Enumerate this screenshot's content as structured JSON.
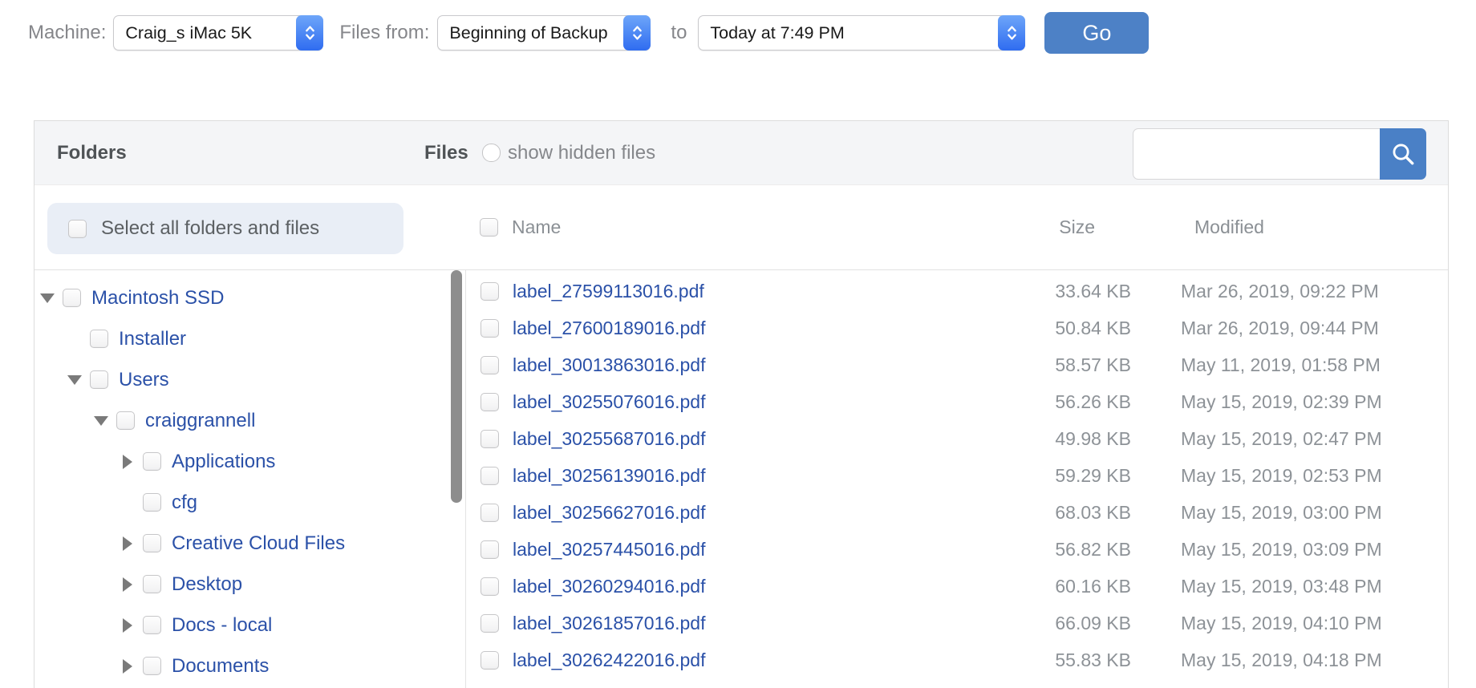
{
  "toolbar": {
    "machine_label": "Machine:",
    "machine_value": "Craig_s iMac 5K",
    "files_from_label": "Files from:",
    "files_from_value": "Beginning of Backup",
    "to_label": "to",
    "to_value": "Today at 7:49 PM",
    "go_label": "Go"
  },
  "panel": {
    "folders_title": "Folders",
    "files_title": "Files",
    "show_hidden_label": "show hidden files",
    "search_placeholder": "",
    "select_all_label": "Select all folders and files",
    "columns": {
      "name": "Name",
      "size": "Size",
      "modified": "Modified"
    }
  },
  "folder_tree": [
    {
      "label": "Macintosh SSD",
      "level": 0,
      "expand": "open"
    },
    {
      "label": "Installer",
      "level": 1,
      "expand": "none"
    },
    {
      "label": "Users",
      "level": 1,
      "expand": "open"
    },
    {
      "label": "craiggrannell",
      "level": 2,
      "expand": "open"
    },
    {
      "label": "Applications",
      "level": 3,
      "expand": "closed"
    },
    {
      "label": "cfg",
      "level": 3,
      "expand": "none"
    },
    {
      "label": "Creative Cloud Files",
      "level": 3,
      "expand": "closed"
    },
    {
      "label": "Desktop",
      "level": 3,
      "expand": "closed"
    },
    {
      "label": "Docs - local",
      "level": 3,
      "expand": "closed"
    },
    {
      "label": "Documents",
      "level": 3,
      "expand": "closed"
    }
  ],
  "files": [
    {
      "name": "label_27599113016.pdf",
      "size": "33.64 KB",
      "modified": "Mar 26, 2019, 09:22 PM"
    },
    {
      "name": "label_27600189016.pdf",
      "size": "50.84 KB",
      "modified": "Mar 26, 2019, 09:44 PM"
    },
    {
      "name": "label_30013863016.pdf",
      "size": "58.57 KB",
      "modified": "May 11, 2019, 01:58 PM"
    },
    {
      "name": "label_30255076016.pdf",
      "size": "56.26 KB",
      "modified": "May 15, 2019, 02:39 PM"
    },
    {
      "name": "label_30255687016.pdf",
      "size": "49.98 KB",
      "modified": "May 15, 2019, 02:47 PM"
    },
    {
      "name": "label_30256139016.pdf",
      "size": "59.29 KB",
      "modified": "May 15, 2019, 02:53 PM"
    },
    {
      "name": "label_30256627016.pdf",
      "size": "68.03 KB",
      "modified": "May 15, 2019, 03:00 PM"
    },
    {
      "name": "label_30257445016.pdf",
      "size": "56.82 KB",
      "modified": "May 15, 2019, 03:09 PM"
    },
    {
      "name": "label_30260294016.pdf",
      "size": "60.16 KB",
      "modified": "May 15, 2019, 03:48 PM"
    },
    {
      "name": "label_30261857016.pdf",
      "size": "66.09 KB",
      "modified": "May 15, 2019, 04:10 PM"
    },
    {
      "name": "label_30262422016.pdf",
      "size": "55.83 KB",
      "modified": "May 15, 2019, 04:18 PM"
    }
  ],
  "colors": {
    "go_button_blue": "#4d81c6",
    "search_button_blue": "#4a80c6",
    "link_blue": "#2b51a8",
    "select_stepper_blue": "#3f7ef8",
    "header_band_gray": "#f4f5f7",
    "select_all_pill": "#e9eef6"
  }
}
